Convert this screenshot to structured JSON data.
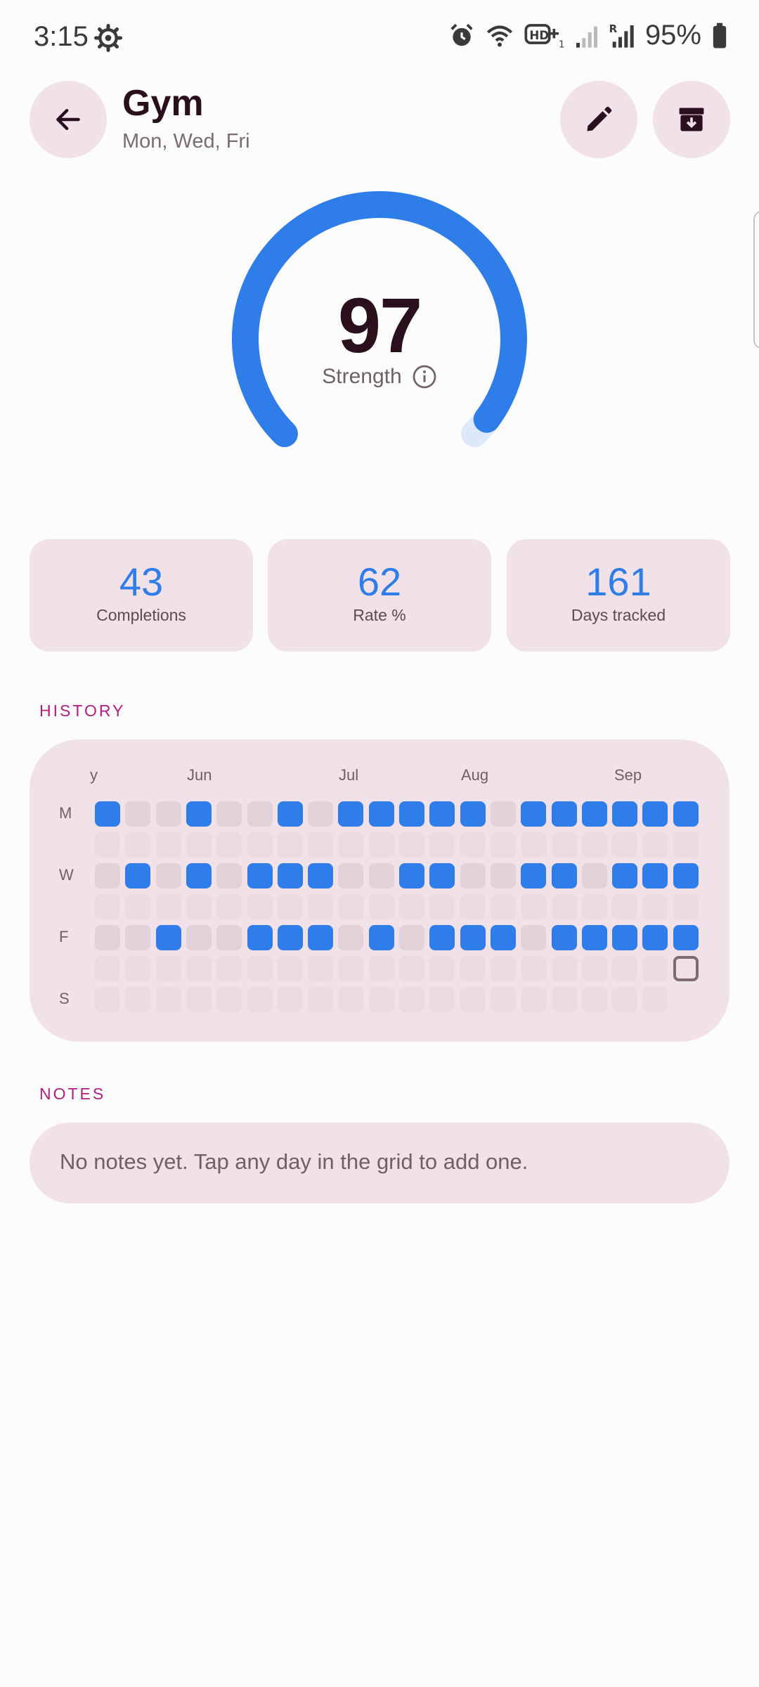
{
  "status_bar": {
    "time": "3:15",
    "battery": "95%",
    "icons": [
      "settings-gear-icon",
      "alarm-icon",
      "wifi-icon",
      "hd-plus-icon",
      "signal-icon",
      "signal-r-icon",
      "battery-icon"
    ]
  },
  "header": {
    "title": "Gym",
    "schedule": "Mon, Wed, Fri",
    "back_icon": "arrow-left-icon",
    "edit_icon": "pencil-icon",
    "archive_icon": "archive-icon"
  },
  "strength": {
    "score": "97",
    "label": "Strength",
    "fraction": 0.97,
    "accent": "#2f7de9",
    "track": "#dde8fb"
  },
  "stats": [
    {
      "value": "43",
      "label": "Completions"
    },
    {
      "value": "62",
      "label": "Rate %"
    },
    {
      "value": "161",
      "label": "Days tracked"
    }
  ],
  "history": {
    "section_label": "HISTORY",
    "months": [
      "y",
      "Jun",
      "Jul",
      "Aug",
      "Sep"
    ],
    "day_labels": [
      "M",
      "W",
      "F",
      "S"
    ],
    "rows": [
      "DMMDMMDMDDDDDMDDDDDD",
      "EEEEEEEEEEEEEEEEEEEE",
      "MDMDMDDDMMDDMMDDMDDD",
      "EEEEEEEEEEEEEEEEEEEE",
      "MMDMMDDDMDMDDDMDDDDD",
      "EEEEEEEEEEEEEEEEEEET",
      "EEEEEEEEEEEEEEEEEEE-"
    ],
    "done_color": "#2f7de9",
    "miss_color": "#e2d2d9",
    "empty_color": "#ebdbe2"
  },
  "notes": {
    "section_label": "NOTES",
    "empty_text": "No notes yet. Tap any day in the grid to add one."
  }
}
